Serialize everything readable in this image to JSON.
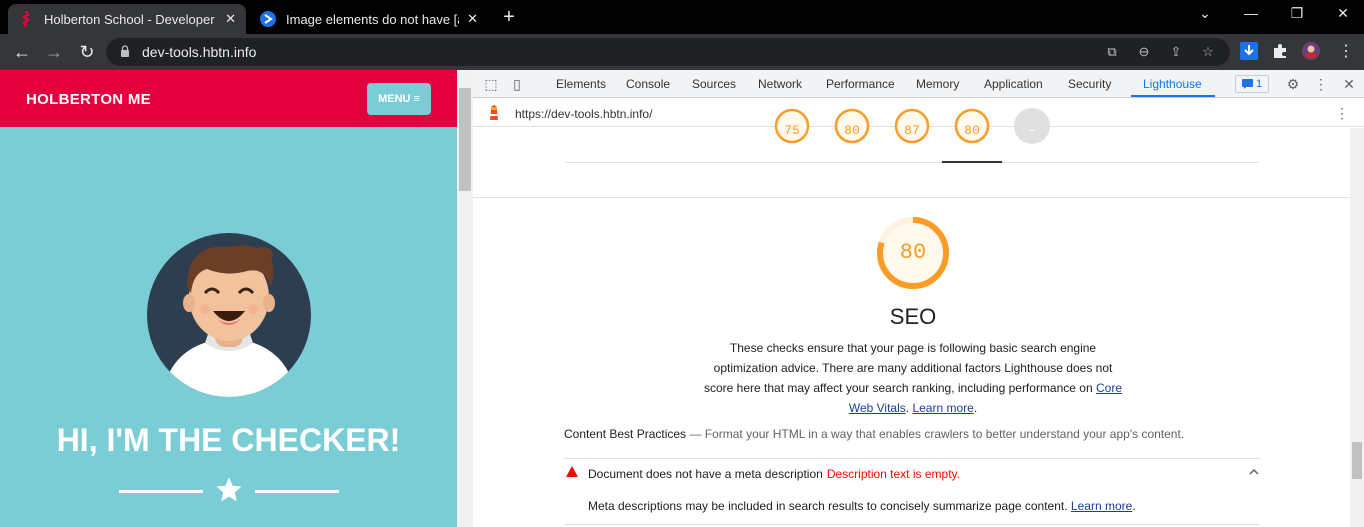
{
  "browser": {
    "tabs": [
      {
        "title": "Holberton School - Developer to",
        "active": true
      },
      {
        "title": "Image elements do not have [alt]",
        "active": false
      }
    ],
    "url": "dev-tools.hbtn.info"
  },
  "page": {
    "brand": "HOLBERTON ME",
    "menu_label": "MENU ≡",
    "hero_title": "HI, I'M THE CHECKER!",
    "colors": {
      "header": "#e4003c",
      "background": "#7acdd4"
    }
  },
  "devtools": {
    "tabs": [
      "Elements",
      "Console",
      "Sources",
      "Network",
      "Performance",
      "Memory",
      "Application",
      "Security",
      "Lighthouse"
    ],
    "active_tab": "Lighthouse",
    "issues_count": "1",
    "report_url": "https://dev-tools.hbtn.info/",
    "mini_scores": [
      "75",
      "80",
      "87",
      "80",
      "–"
    ],
    "category": {
      "score": "80",
      "title": "SEO",
      "description": "These checks ensure that your page is following basic search engine optimization advice. There are many additional factors Lighthouse does not score here that may affect your search ranking, including performance on",
      "link_cwv": "Core Web Vitals",
      "link_learn": "Learn more",
      "score_color": "#fa9c27"
    },
    "group": {
      "title": "Content Best Practices",
      "dash": " — ",
      "subtitle": "Format your HTML in a way that enables crawlers to better understand your app's content."
    },
    "audit": {
      "title": "Document does not have a meta description",
      "display_value": "Description text is empty.",
      "description": "Meta descriptions may be included in search results to concisely summarize page content.",
      "learn_more": "Learn more"
    }
  }
}
